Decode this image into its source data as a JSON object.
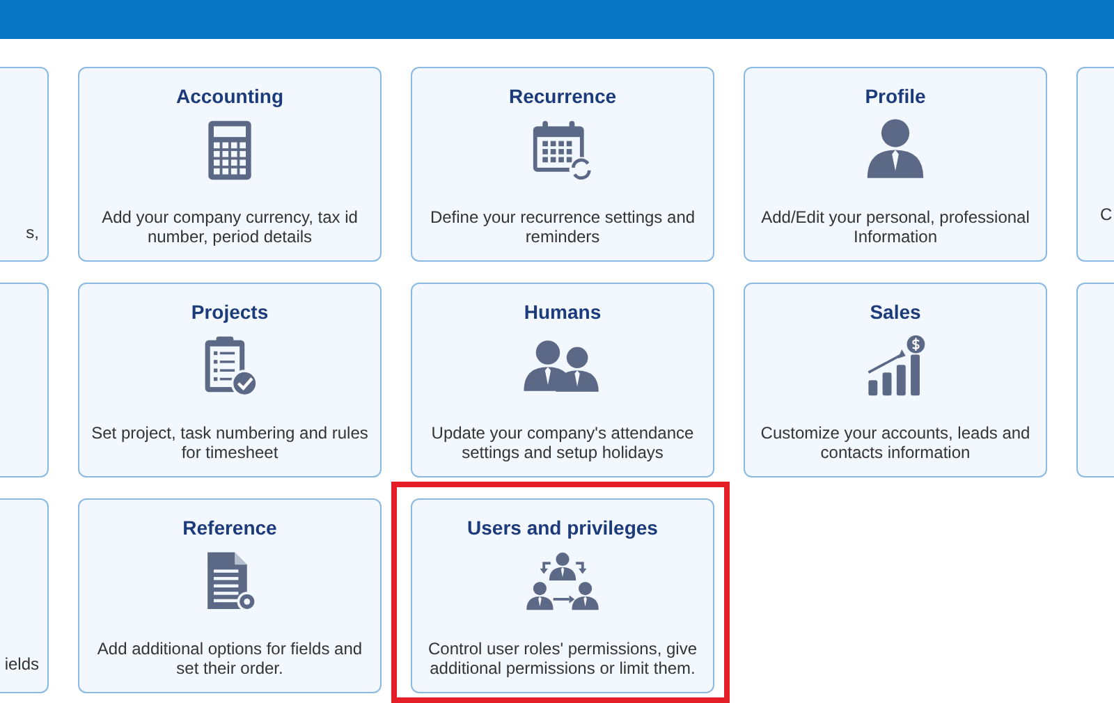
{
  "cards": [
    {
      "kind": "partial-left",
      "description": "s,",
      "highlighted": false
    },
    {
      "kind": "full",
      "title": "Accounting",
      "description": "Add your company currency, tax id number, period details",
      "highlighted": false
    },
    {
      "kind": "full",
      "title": "Recurrence",
      "description": "Define your recurrence settings and reminders",
      "highlighted": false
    },
    {
      "kind": "full",
      "title": "Profile",
      "description": "Add/Edit your personal, professional Information",
      "highlighted": false
    },
    {
      "kind": "partial-right",
      "description": "C",
      "highlighted": false
    },
    {
      "kind": "partial-left",
      "highlighted": false
    },
    {
      "kind": "full",
      "title": "Projects",
      "description": "Set project, task numbering and rules for timesheet",
      "highlighted": false
    },
    {
      "kind": "full",
      "title": "Humans",
      "description": "Update your company's attendance settings and setup holidays",
      "highlighted": false
    },
    {
      "kind": "full",
      "title": "Sales",
      "description": "Customize your accounts, leads and contacts information",
      "highlighted": false
    },
    {
      "kind": "partial-right",
      "highlighted": false
    },
    {
      "kind": "partial-left",
      "description": "ields",
      "highlighted": false
    },
    {
      "kind": "full",
      "title": "Reference",
      "description": "Add additional options for fields and set their order.",
      "highlighted": false
    },
    {
      "kind": "full",
      "title": "Users and privileges",
      "description": "Control user roles' permissions, give additional permissions or limit them.",
      "highlighted": true
    }
  ]
}
